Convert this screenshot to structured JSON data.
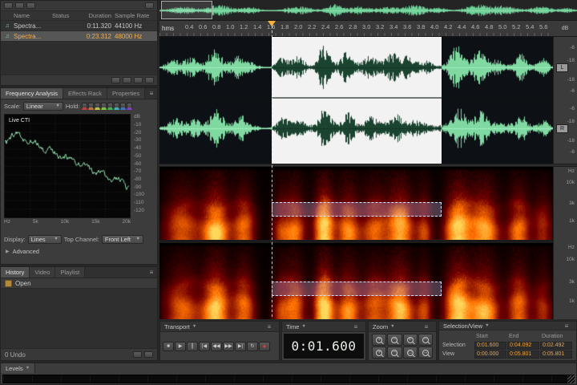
{
  "files": {
    "columns": [
      "Name",
      "Status",
      "Duration",
      "Sample Rate"
    ],
    "rows": [
      {
        "name": "Spectra...",
        "status": "",
        "duration": "0:11.320",
        "sample_rate": "44100 Hz"
      },
      {
        "name": "Spectra...",
        "status": "",
        "duration": "0:23.312",
        "sample_rate": "48000 Hz"
      }
    ]
  },
  "frequency": {
    "tabs": [
      "Frequency Analysis",
      "Effects Rack",
      "Properties"
    ],
    "scale_label": "Scale:",
    "scale_value": "Linear",
    "hold_label": "Hold:",
    "hold_colors": [
      "#c04040",
      "#c07040",
      "#c0c040",
      "#80c040",
      "#40b050",
      "#40b0b0",
      "#4070c0",
      "#8040c0"
    ],
    "graph_overlay": "Live CTI",
    "db_unit": "dB",
    "db_ticks": [
      "-10",
      "-20",
      "-30",
      "-40",
      "-50",
      "-60",
      "-70",
      "-80",
      "-90",
      "-100",
      "-110",
      "-120"
    ],
    "hz_ticks": [
      "Hz",
      "5k",
      "10k",
      "15k",
      "20k"
    ],
    "display_label": "Display:",
    "display_value": "Lines",
    "top_channel_label": "Top Channel:",
    "top_channel_value": "Front Left",
    "advanced_label": "Advanced"
  },
  "history": {
    "tabs": [
      "History",
      "Video",
      "Playlist"
    ],
    "items": [
      "Open"
    ],
    "status_left": "0 Undo"
  },
  "timeline": {
    "unit_label": "hms",
    "ticks": [
      "0.4",
      "0.6",
      "0.8",
      "1.0",
      "1.2",
      "1.4",
      "1.6",
      "1.8",
      "2.0",
      "2.2",
      "2.4",
      "2.6",
      "2.8",
      "3.0",
      "3.2",
      "3.4",
      "3.6",
      "3.8",
      "4.0",
      "4.2",
      "4.4",
      "4.6",
      "4.8",
      "5.0",
      "5.2",
      "5.4",
      "5.6"
    ]
  },
  "wave_scale": {
    "unit": "dB",
    "ticks": [
      "-6",
      "-18"
    ],
    "channels": [
      "L",
      "R"
    ]
  },
  "spec_scale": {
    "unit": "Hz",
    "ticks": [
      "10k",
      "3k",
      "1k"
    ]
  },
  "transport": {
    "title": "Transport",
    "buttons": [
      {
        "name": "stop-button",
        "glyph": "■"
      },
      {
        "name": "play-button",
        "glyph": "▶"
      },
      {
        "name": "pause-button",
        "glyph": "║"
      },
      {
        "name": "skip-back-button",
        "glyph": "|◀"
      },
      {
        "name": "rewind-button",
        "glyph": "◀◀"
      },
      {
        "name": "fast-forward-button",
        "glyph": "▶▶"
      },
      {
        "name": "skip-forward-button",
        "glyph": "▶|"
      },
      {
        "name": "loop-button",
        "glyph": "↻"
      },
      {
        "name": "record-button",
        "glyph": "●"
      }
    ]
  },
  "time": {
    "title": "Time",
    "value": "0:01.600"
  },
  "zoom": {
    "title": "Zoom",
    "buttons": [
      {
        "name": "zoom-in-button",
        "glyph": "+"
      },
      {
        "name": "zoom-out-button",
        "glyph": "−"
      },
      {
        "name": "zoom-in-horizontal-button",
        "glyph": "+"
      },
      {
        "name": "zoom-out-horizontal-button",
        "glyph": "−"
      },
      {
        "name": "zoom-in-vertical-button",
        "glyph": "+"
      },
      {
        "name": "zoom-out-vertical-button",
        "glyph": "−"
      },
      {
        "name": "zoom-selection-button",
        "glyph": "□"
      },
      {
        "name": "zoom-full-button",
        "glyph": "↔"
      }
    ]
  },
  "selection_view": {
    "title": "Selection/View",
    "columns": [
      "Start",
      "End",
      "Duration"
    ],
    "rows": [
      {
        "label": "Selection",
        "start": "0:01.600",
        "end": "0:04.092",
        "duration": "0:02.492"
      },
      {
        "label": "View",
        "start": "0:00.000",
        "end": "0:05.801",
        "duration": "0:05.801"
      }
    ]
  },
  "levels": {
    "title": "Levels"
  },
  "colors": {
    "accent_orange": "#f0a43c",
    "waveform_green": "#7fd9a0",
    "selection_white": "#f2f2f2"
  }
}
